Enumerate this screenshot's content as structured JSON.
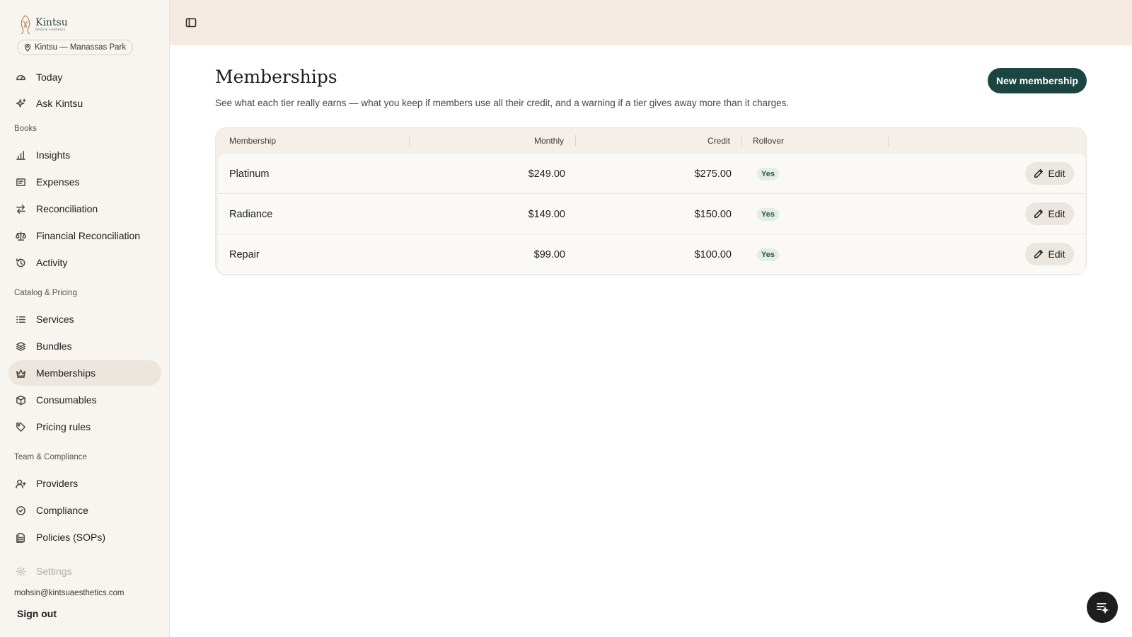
{
  "brand": {
    "name": "Kintsu",
    "tagline": "Medical Aesthetics"
  },
  "location": {
    "label": "Kintsu — Manassas Park",
    "icon": "map-pin-icon"
  },
  "sidebar": {
    "top_items": [
      {
        "label": "Today",
        "icon": "gauge-icon"
      },
      {
        "label": "Ask Kintsu",
        "icon": "sparkle-icon"
      }
    ],
    "sections": [
      {
        "title": "Books",
        "items": [
          {
            "label": "Insights",
            "icon": "bar-chart-icon"
          },
          {
            "label": "Expenses",
            "icon": "receipt-icon"
          },
          {
            "label": "Reconciliation",
            "icon": "arrows-swap-icon"
          },
          {
            "label": "Financial Reconciliation",
            "icon": "scale-icon"
          },
          {
            "label": "Activity",
            "icon": "history-icon"
          }
        ]
      },
      {
        "title": "Catalog & Pricing",
        "items": [
          {
            "label": "Services",
            "icon": "list-icon"
          },
          {
            "label": "Bundles",
            "icon": "layers-icon"
          },
          {
            "label": "Memberships",
            "icon": "crown-icon",
            "active": true
          },
          {
            "label": "Consumables",
            "icon": "box-icon"
          },
          {
            "label": "Pricing rules",
            "icon": "tag-icon"
          }
        ]
      },
      {
        "title": "Team & Compliance",
        "items": [
          {
            "label": "Providers",
            "icon": "user-plus-icon"
          },
          {
            "label": "Compliance",
            "icon": "badge-check-icon"
          },
          {
            "label": "Policies (SOPs)",
            "icon": "document-icon"
          }
        ]
      }
    ],
    "settings": {
      "label": "Settings",
      "icon": "gear-icon"
    },
    "user_email": "mohsin@kintsuaesthetics.com",
    "sign_out": "Sign out"
  },
  "page": {
    "title": "Memberships",
    "subtitle": "See what each tier really earns — what you keep if members use all their credit, and a warning if a tier gives away more than it charges.",
    "new_button": "New membership"
  },
  "table": {
    "columns": [
      "Membership",
      "Monthly",
      "Credit",
      "Rollover"
    ],
    "rows": [
      {
        "name": "Platinum",
        "monthly": "$249.00",
        "credit": "$275.00",
        "rollover": "Yes",
        "action": "Edit"
      },
      {
        "name": "Radiance",
        "monthly": "$149.00",
        "credit": "$150.00",
        "rollover": "Yes",
        "action": "Edit"
      },
      {
        "name": "Repair",
        "monthly": "$99.00",
        "credit": "$100.00",
        "rollover": "Yes",
        "action": "Edit"
      }
    ]
  },
  "colors": {
    "accent": "#1c4542",
    "sidebar_bg": "#f8f4f0",
    "topbar_bg": "#f5ebe3",
    "badge_bg": "#e3ede5",
    "badge_text": "#2c5a3a"
  }
}
